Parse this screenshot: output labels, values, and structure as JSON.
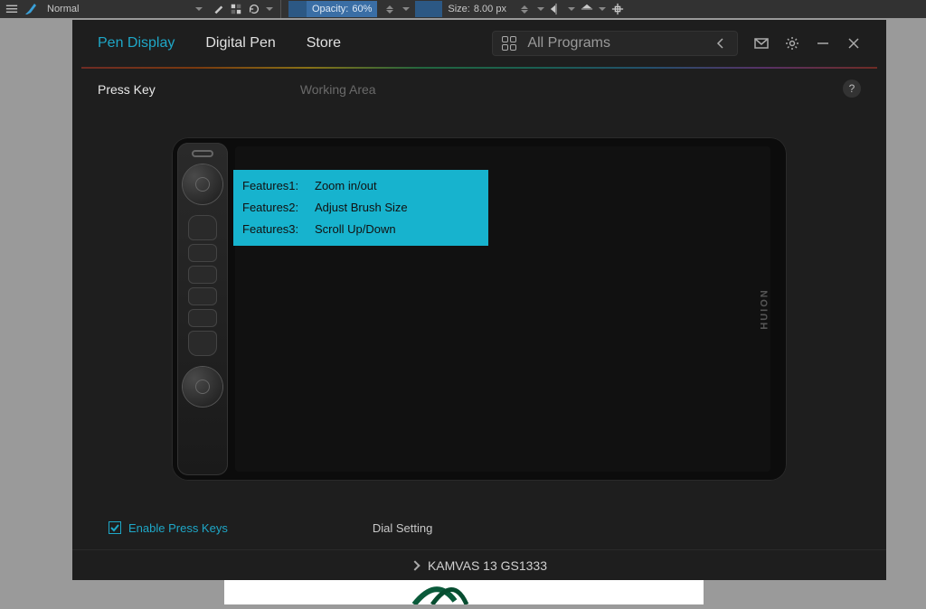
{
  "toolbar": {
    "blend_mode": "Normal",
    "opacity_label": "Opacity:",
    "opacity_value": "60%",
    "size_label": "Size:",
    "size_value": "8.00 px"
  },
  "dialog": {
    "tabs": {
      "pen_display": "Pen Display",
      "digital_pen": "Digital Pen",
      "store": "Store"
    },
    "all_programs": "All Programs",
    "subtabs": {
      "press_key": "Press Key",
      "working_area": "Working Area"
    },
    "help_char": "?",
    "brand": "HUION",
    "tooltip": {
      "f1_label": "Features1:",
      "f1_value": "Zoom in/out",
      "f2_label": "Features2:",
      "f2_value": "Adjust Brush Size",
      "f3_label": "Features3:",
      "f3_value": "Scroll Up/Down"
    },
    "enable_press_keys": "Enable Press Keys",
    "dial_setting": "Dial Setting",
    "device_name": "KAMVAS 13 GS1333"
  }
}
